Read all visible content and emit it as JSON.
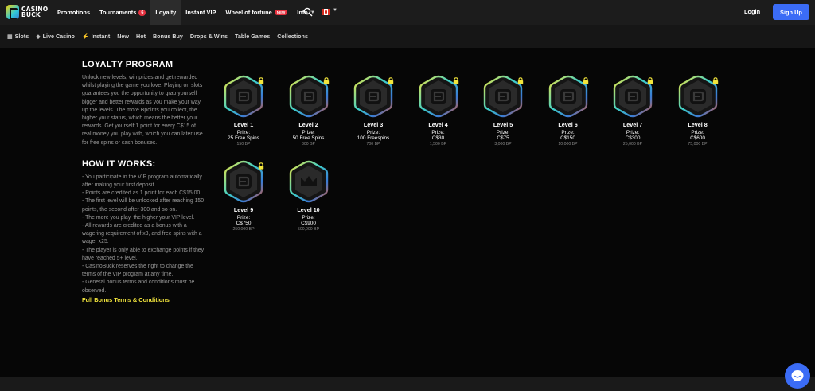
{
  "header": {
    "logo_line1": "CASINO",
    "logo_line2": "BUCK",
    "nav": [
      {
        "label": "Promotions"
      },
      {
        "label": "Tournaments",
        "badge": "6"
      },
      {
        "label": "Loyalty"
      },
      {
        "label": "Instant VIP"
      },
      {
        "label": "Wheel of fortune",
        "badge": "NEW"
      },
      {
        "label": "Info"
      }
    ],
    "login_label": "Login",
    "signup_label": "Sign Up",
    "search_icon": "search-icon",
    "flag_icon": "canada-flag-icon"
  },
  "subnav": [
    {
      "label": "Slots",
      "icon": "slots-icon"
    },
    {
      "label": "Live Casino",
      "icon": "diamond-icon"
    },
    {
      "label": "Instant",
      "icon": "bolt-icon"
    },
    {
      "label": "New"
    },
    {
      "label": "Hot"
    },
    {
      "label": "Bonus Buy"
    },
    {
      "label": "Drops & Wins"
    },
    {
      "label": "Table Games"
    },
    {
      "label": "Collections"
    }
  ],
  "loyalty": {
    "title": "LOYALTY PROGRAM",
    "description": "Unlock new levels, win prizes and get rewarded whilst playing the game you love. Playing on slots guarantees you the opportunity to grab yourself bigger and better rewards as you make your way up the levels. The more Bpoints you collect, the higher your status, which means the better your rewards. Get yourself 1 point for every C$15 of real money you play with, which you can later use for free spins or cash bonuses.",
    "how_title": "HOW IT WORKS:",
    "how_lines": [
      "- You participate in the VIP program automatically after making your first deposit.",
      "- Points are credited as 1 point for each C$15.00.",
      "- The first level will be unlocked after reaching 150 points, the second after 300 and so on.",
      "- The more you play, the higher your VIP level.",
      "- All rewards are credited as a bonus with a wagering requirement of x3, and free spins with a wager x25.",
      "- The player is only able to exchange points if they have reached 5+ level.",
      "- CasinoBuck reserves the right to change the terms of the VIP program at any time.",
      "- General bonus terms and conditions must be observed."
    ],
    "terms_link": "Full Bonus Terms & Conditions"
  },
  "levels": [
    {
      "name": "Level 1",
      "prize_label": "Prize:",
      "prize": "25 Free Spins",
      "points": "150 BP",
      "icon": "b-logo-icon"
    },
    {
      "name": "Level 2",
      "prize_label": "Prize:",
      "prize": "50 Free Spins",
      "points": "300 BP",
      "icon": "b-logo-icon"
    },
    {
      "name": "Level 3",
      "prize_label": "Prize:",
      "prize": "100 Freespins",
      "points": "700 BP",
      "icon": "b-logo-icon"
    },
    {
      "name": "Level 4",
      "prize_label": "Prize:",
      "prize": "C$30",
      "points": "1,500 BP",
      "icon": "b-logo-icon"
    },
    {
      "name": "Level 5",
      "prize_label": "Prize:",
      "prize": "C$75",
      "points": "3,000 BP",
      "icon": "b-logo-icon"
    },
    {
      "name": "Level 6",
      "prize_label": "Prize:",
      "prize": "C$150",
      "points": "10,000 BP",
      "icon": "b-logo-icon"
    },
    {
      "name": "Level 7",
      "prize_label": "Prize:",
      "prize": "C$300",
      "points": "25,000 BP",
      "icon": "b-logo-icon"
    },
    {
      "name": "Level 8",
      "prize_label": "Prize:",
      "prize": "C$600",
      "points": "75,000 BP",
      "icon": "b-logo-icon"
    },
    {
      "name": "Level 9",
      "prize_label": "Prize:",
      "prize": "C$750",
      "points": "250,000 BP",
      "icon": "b-logo-icon"
    },
    {
      "name": "Level 10",
      "prize_label": "Prize:",
      "prize": "C$900",
      "points": "500,000 BP",
      "icon": "crown-icon"
    }
  ],
  "chat_icon": "chat-icon"
}
